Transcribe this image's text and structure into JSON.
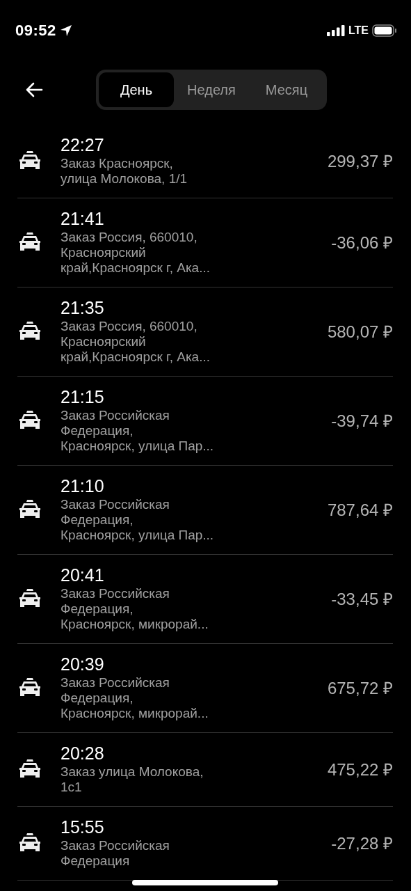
{
  "status_bar": {
    "time": "09:52",
    "network": "LTE"
  },
  "tabs": [
    {
      "label": "День",
      "selected": true
    },
    {
      "label": "Неделя",
      "selected": false
    },
    {
      "label": "Месяц",
      "selected": false
    }
  ],
  "orders": [
    {
      "time": "22:27",
      "lines": [
        "Заказ Красноярск,",
        "улица Молокова, 1/1"
      ],
      "amount": "299,37 ₽"
    },
    {
      "time": "21:41",
      "lines": [
        "Заказ Россия, 660010,",
        "Красноярский",
        "край,Красноярск г, Ака..."
      ],
      "amount": "-36,06 ₽"
    },
    {
      "time": "21:35",
      "lines": [
        "Заказ Россия, 660010,",
        "Красноярский",
        "край,Красноярск г, Ака..."
      ],
      "amount": "580,07 ₽"
    },
    {
      "time": "21:15",
      "lines": [
        "Заказ Российская",
        "Федерация,",
        "Красноярск, улица Пар..."
      ],
      "amount": "-39,74 ₽"
    },
    {
      "time": "21:10",
      "lines": [
        "Заказ Российская",
        "Федерация,",
        "Красноярск, улица Пар..."
      ],
      "amount": "787,64 ₽"
    },
    {
      "time": "20:41",
      "lines": [
        "Заказ Российская",
        "Федерация,",
        "Красноярск, микрорай..."
      ],
      "amount": "-33,45 ₽"
    },
    {
      "time": "20:39",
      "lines": [
        "Заказ Российская",
        "Федерация,",
        "Красноярск, микрорай..."
      ],
      "amount": "675,72 ₽"
    },
    {
      "time": "20:28",
      "lines": [
        "Заказ улица Молокова,",
        "1с1"
      ],
      "amount": "475,22 ₽"
    },
    {
      "time": "15:55",
      "lines": [
        "Заказ Российская",
        "Федерация"
      ],
      "amount": "-27,28 ₽"
    }
  ]
}
